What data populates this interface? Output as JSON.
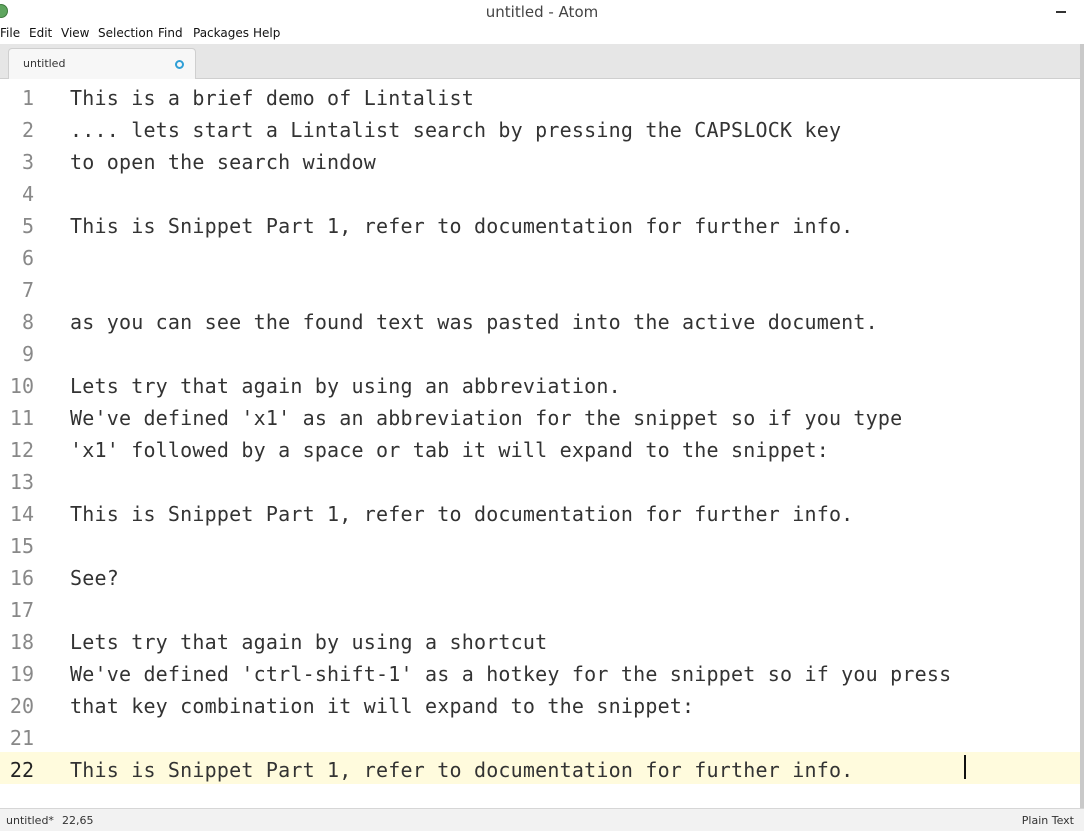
{
  "window": {
    "title": "untitled - Atom"
  },
  "menu": {
    "items": [
      "File",
      "Edit",
      "View",
      "Selection",
      "Find",
      "Packages",
      "Help"
    ]
  },
  "tabs": [
    {
      "label": "untitled",
      "modified": true
    }
  ],
  "editor": {
    "lines": [
      {
        "num": "1",
        "text": "This is a brief demo of Lintalist"
      },
      {
        "num": "2",
        "text": ".... lets start a Lintalist search by pressing the CAPSLOCK key"
      },
      {
        "num": "3",
        "text": "to open the search window"
      },
      {
        "num": "4",
        "text": ""
      },
      {
        "num": "5",
        "text": "This is Snippet Part 1, refer to documentation for further info."
      },
      {
        "num": "6",
        "text": ""
      },
      {
        "num": "7",
        "text": ""
      },
      {
        "num": "8",
        "text": "as you can see the found text was pasted into the active document."
      },
      {
        "num": "9",
        "text": ""
      },
      {
        "num": "10",
        "text": "Lets try that again by using an abbreviation."
      },
      {
        "num": "11",
        "text": "We've defined 'x1' as an abbreviation for the snippet so if you type"
      },
      {
        "num": "12",
        "text": "'x1' followed by a space or tab it will expand to the snippet:"
      },
      {
        "num": "13",
        "text": ""
      },
      {
        "num": "14",
        "text": "This is Snippet Part 1, refer to documentation for further info."
      },
      {
        "num": "15",
        "text": ""
      },
      {
        "num": "16",
        "text": "See?"
      },
      {
        "num": "17",
        "text": ""
      },
      {
        "num": "18",
        "text": "Lets try that again by using a shortcut"
      },
      {
        "num": "19",
        "text": "We've defined 'ctrl-shift-1' as a hotkey for the snippet so if you press"
      },
      {
        "num": "20",
        "text": "that key combination it will expand to the snippet:"
      },
      {
        "num": "21",
        "text": ""
      },
      {
        "num": "22",
        "text": "This is Snippet Part 1, refer to documentation for further info."
      }
    ],
    "cursor_line": "22"
  },
  "status": {
    "file": "untitled*",
    "cursor": "22,65",
    "grammar": "Plain Text"
  },
  "colors": {
    "cursor_line_bg": "#fffbdd",
    "modified_indicator": "#2f9fd6"
  }
}
